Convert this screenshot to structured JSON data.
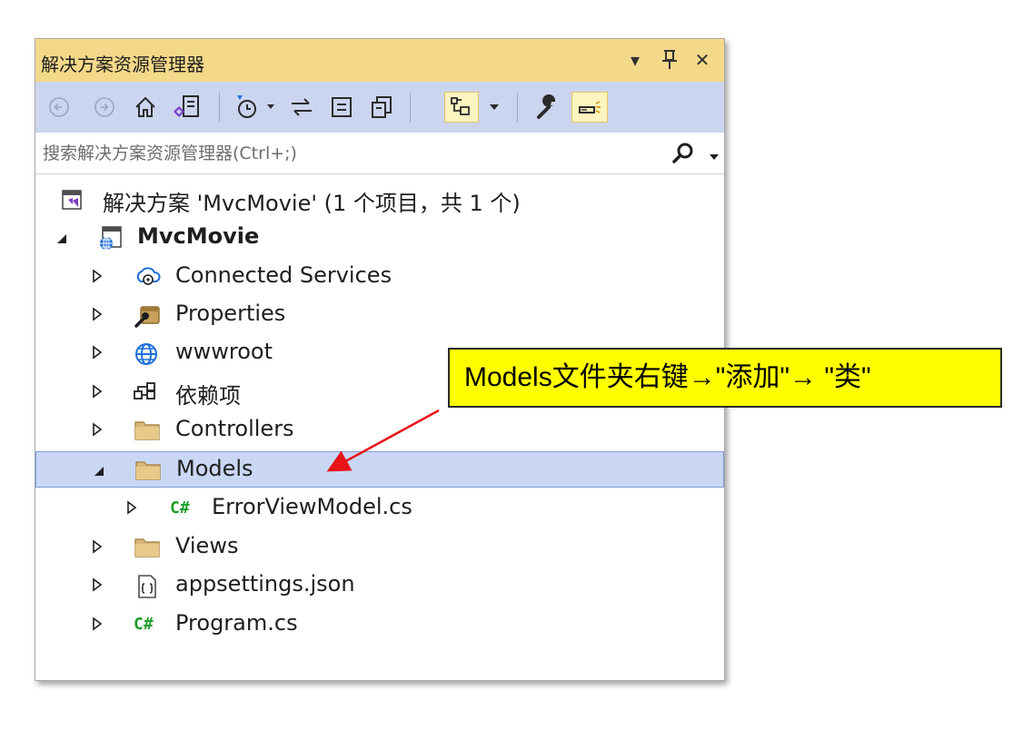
{
  "panel": {
    "title": "解决方案资源管理器",
    "title_buttons": [
      "▾",
      "ᚁ",
      "✕"
    ]
  },
  "toolbar": {
    "buttons": [
      "back-icon",
      "forward-icon",
      "home-icon",
      "switch-views-icon",
      "pending-changes-filter-icon",
      "sync-icon",
      "collapse-all-icon",
      "show-all-files-icon",
      "preview-selected-items-icon",
      "properties-icon",
      "preview-icon"
    ]
  },
  "search": {
    "placeholder": "搜索解决方案资源管理器(Ctrl+;)"
  },
  "tree": {
    "solution": "解决方案 'MvcMovie' (1 个项目，共 1 个)",
    "project": "MvcMovie",
    "items": [
      {
        "label": "Connected Services",
        "icon": "cloud-services-icon"
      },
      {
        "label": "Properties",
        "icon": "properties-wrench-icon"
      },
      {
        "label": "wwwroot",
        "icon": "globe-icon"
      },
      {
        "label": "依赖项",
        "icon": "dependencies-icon"
      },
      {
        "label": "Controllers",
        "icon": "folder-icon"
      },
      {
        "label": "Models",
        "icon": "folder-icon",
        "selected": true,
        "expanded": true
      },
      {
        "label": "ErrorViewModel.cs",
        "icon": "csharp-file-icon"
      },
      {
        "label": "Views",
        "icon": "folder-icon"
      },
      {
        "label": "appsettings.json",
        "icon": "json-file-icon"
      },
      {
        "label": "Program.cs",
        "icon": "csharp-file-icon"
      }
    ],
    "csharp_badge": "C#"
  },
  "callout": {
    "text": "Models文件夹右键→\"添加\"→ \"类\""
  },
  "colors": {
    "title_bg": "#f5d98a",
    "toolbar_bg": "#ccd5f0",
    "selection_bg": "#c9d7f5",
    "selection_border": "#7f9ad6",
    "callout_bg": "#ffff00",
    "arrow": "#e8141a"
  }
}
